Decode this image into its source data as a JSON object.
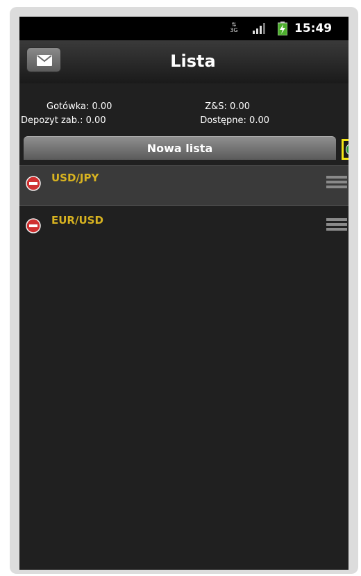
{
  "status_bar": {
    "network_type": "3G",
    "time": "15:49",
    "icons": [
      "network-3g-icon",
      "signal-strength-icon",
      "battery-charging-icon"
    ]
  },
  "header": {
    "title": "Lista",
    "mail_icon": "envelope-icon"
  },
  "account": {
    "cash": "Gotówka: 0.00",
    "pl": "Z&S: 0.00",
    "deposit": "Depozyt zab.: 0.00",
    "available": "Dostępne: 0.00"
  },
  "list": {
    "name": "Nowa lista",
    "add_icon": "plus-circle-icon",
    "items": [
      {
        "symbol": "USD/JPY",
        "selected": true
      },
      {
        "symbol": "EUR/USD",
        "selected": false
      }
    ]
  },
  "colors": {
    "symbol": "#d8b320",
    "highlight": "#f4e514",
    "remove": "#d03030",
    "add": "#2a9a3a",
    "background": "#202020"
  }
}
